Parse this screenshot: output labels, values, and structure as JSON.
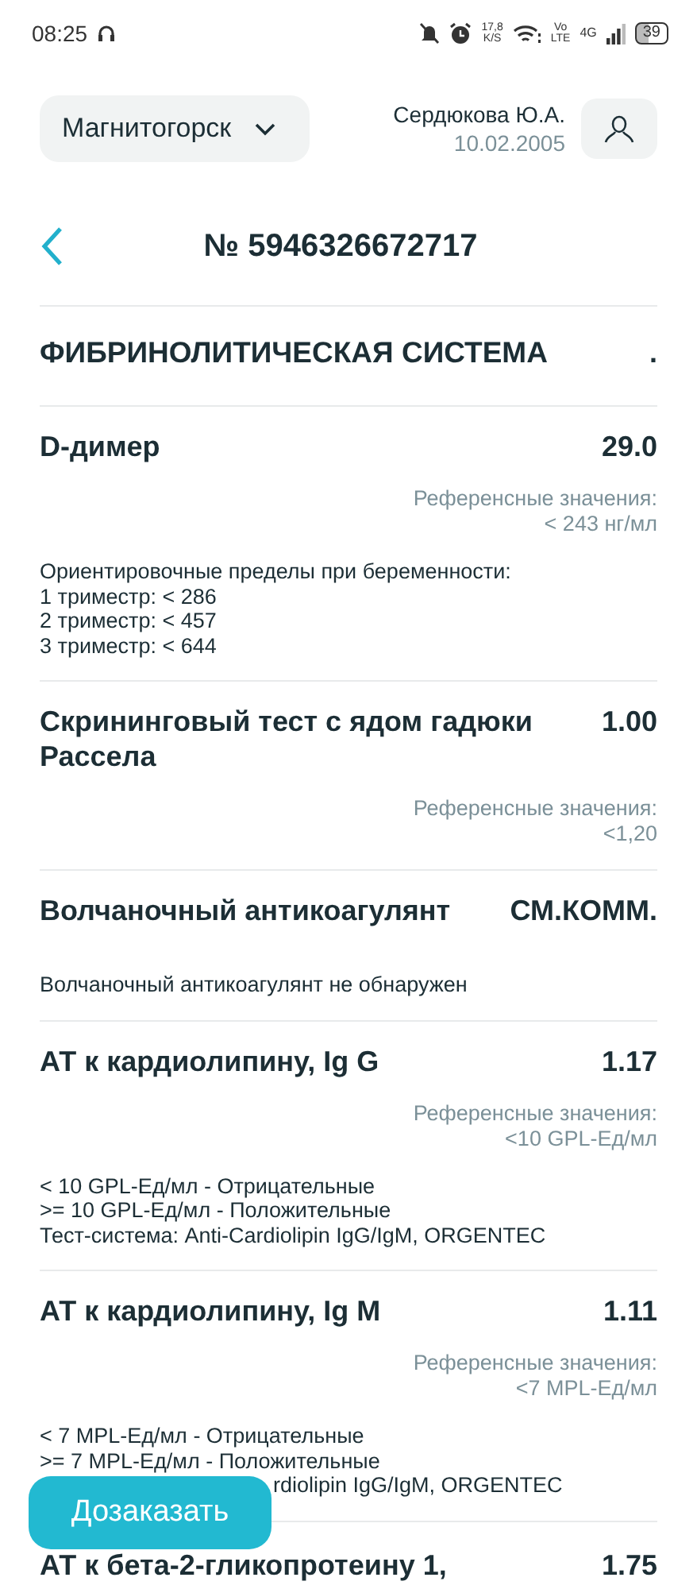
{
  "status_bar": {
    "time": "08:25",
    "speed": "17,8",
    "speed_unit": "K/S",
    "volte_top": "Vo",
    "volte_bottom": "LTE",
    "network": "4G",
    "battery": "39"
  },
  "header": {
    "city": "Магнитогорск",
    "patient_name": "Сердюкова Ю.А.",
    "patient_birthdate": "10.02.2005"
  },
  "title": "№ 5946326672717",
  "rows": [
    {
      "kind": "section",
      "name": "ФИБРИНОЛИТИЧЕСКАЯ СИСТЕМА",
      "value": "."
    },
    {
      "kind": "test",
      "name": "D-димер",
      "value": "29.0",
      "reference_label": "Референсные значения:",
      "reference": "< 243 нг/мл",
      "notes": [
        "Ориентировочные пределы при беременности:",
        "1 триместр: < 286",
        "2 триместр: < 457",
        "3 триместр: < 644"
      ]
    },
    {
      "kind": "test",
      "name": "Скрининговый тест с ядом гадюки Рассела",
      "value": "1.00",
      "reference_label": "Референсные значения:",
      "reference": "<1,20"
    },
    {
      "kind": "test",
      "name": "Волчаночный антикоагулянт",
      "value": "СМ.КОММ.",
      "notes": [
        "Волчаночный антикоагулянт не обнаружен"
      ]
    },
    {
      "kind": "test",
      "name": "АТ к кардиолипину, Ig G",
      "value": "1.17",
      "reference_label": "Референсные значения:",
      "reference": "<10 GPL-Ед/мл",
      "notes": [
        "< 10 GPL-Ед/мл - Отрицательные",
        ">= 10 GPL-Ед/мл - Положительные",
        "Тест-система: Anti-Cardiolipin IgG/IgM, ORGENTEC"
      ]
    },
    {
      "kind": "test",
      "name": "АТ к кардиолипину, Ig M",
      "value": "1.11",
      "reference_label": "Референсные значения:",
      "reference": "<7 MPL-Ед/мл",
      "notes": [
        "< 7 MPL-Ед/мл - Отрицательные",
        ">= 7 MPL-Ед/мл - Положительные"
      ],
      "covered_note": "rdiolipin IgG/IgM, ORGENTEC"
    },
    {
      "kind": "test",
      "name": "АТ к бета-2-гликопротеину 1,",
      "value": "1.75"
    }
  ],
  "order_button": "Дозаказать"
}
